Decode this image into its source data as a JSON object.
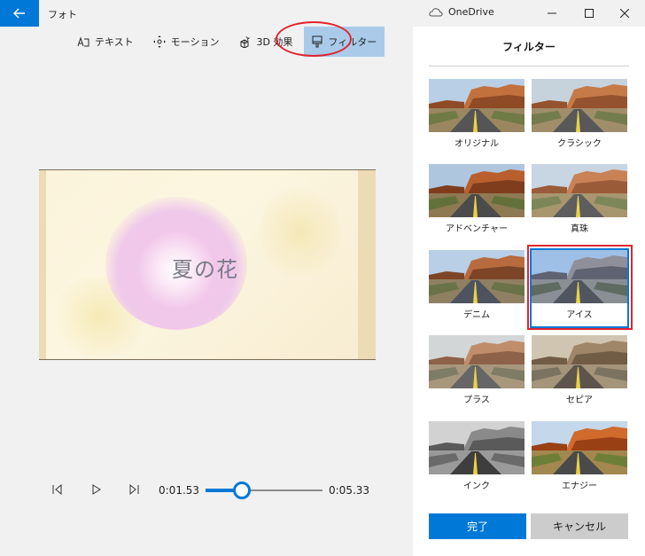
{
  "window": {
    "app_title": "フォト",
    "onedrive_label": "OneDrive"
  },
  "toolbar": {
    "text_label": "テキスト",
    "motion_label": "モーション",
    "effects3d_label": "3D 効果",
    "filter_label": "フィルター"
  },
  "preview": {
    "caption": "夏の花"
  },
  "playback": {
    "current_time": "0:01.53",
    "total_time": "0:05.33",
    "progress": 0.31
  },
  "panel": {
    "title": "フィルター",
    "filters": [
      {
        "label": "オリジナル",
        "style": "original",
        "selected": false
      },
      {
        "label": "クラシック",
        "style": "classic",
        "selected": false
      },
      {
        "label": "アドベンチャー",
        "style": "adventure",
        "selected": false
      },
      {
        "label": "真珠",
        "style": "pearl",
        "selected": false
      },
      {
        "label": "デニム",
        "style": "denim",
        "selected": false
      },
      {
        "label": "アイス",
        "style": "ice",
        "selected": true
      },
      {
        "label": "プラス",
        "style": "plus",
        "selected": false
      },
      {
        "label": "セピア",
        "style": "sepia",
        "selected": false
      },
      {
        "label": "インク",
        "style": "ink",
        "selected": false
      },
      {
        "label": "エナジー",
        "style": "energy",
        "selected": false
      }
    ],
    "done_label": "完了",
    "cancel_label": "キャンセル"
  },
  "colors": {
    "accent": "#0078d7",
    "highlight": "#e0242e",
    "active_tool_bg": "#a9cbe9"
  }
}
